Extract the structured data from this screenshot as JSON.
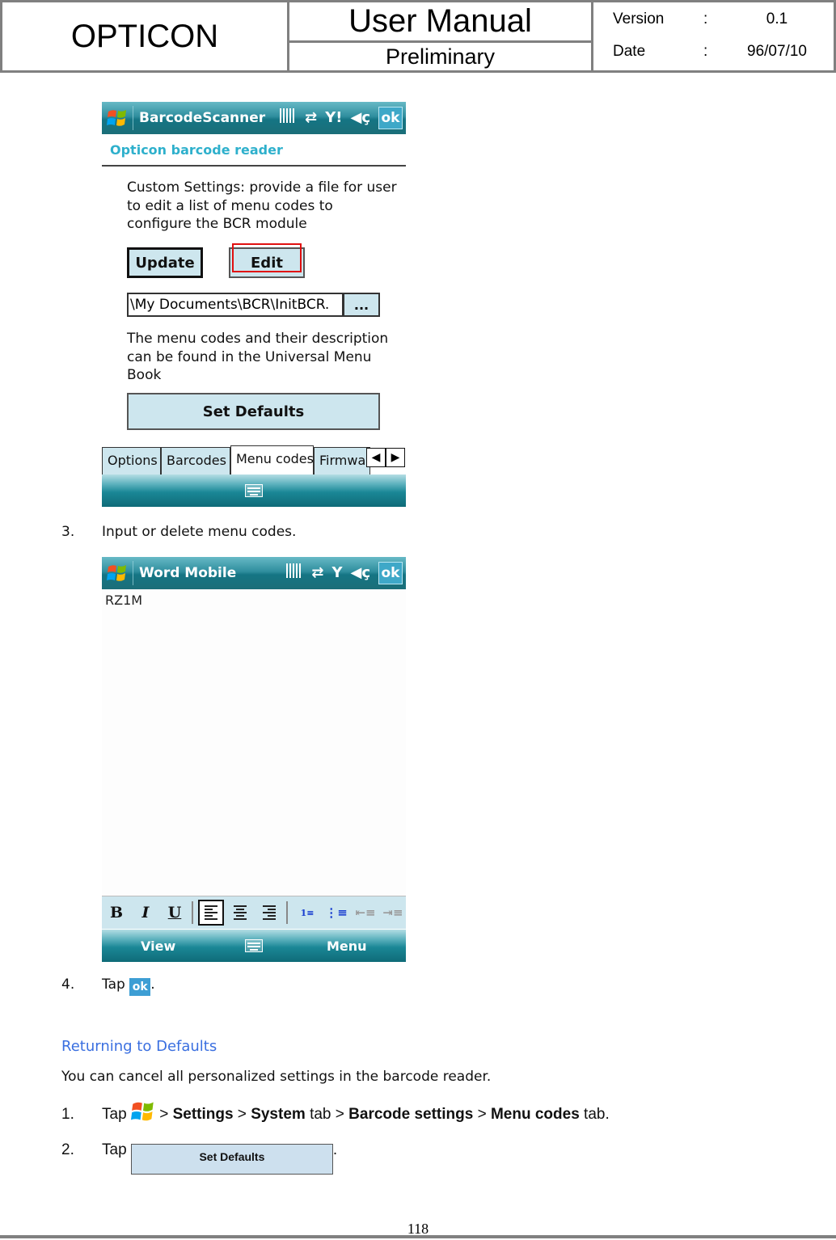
{
  "header": {
    "brand": "OPTICON",
    "title": "User Manual",
    "subtitle": "Preliminary",
    "version_label": "Version",
    "version_sep": ":",
    "version_value": "0.1",
    "date_label": "Date",
    "date_sep": ":",
    "date_value": "96/07/10"
  },
  "screen1": {
    "app_title": "BarcodeScanner",
    "title_icons": [
      "barcode-icon",
      "connectivity-icon",
      "signal-icon",
      "volume-icon"
    ],
    "ok_label": "ok",
    "app_header": "Opticon barcode reader",
    "description": "Custom Settings: provide a file for user to edit a list of menu codes to configure the BCR module",
    "update_label": "Update",
    "edit_label": "Edit",
    "file_path": "\\My Documents\\BCR\\InitBCR.",
    "browse_label": "...",
    "info_text": "The menu codes and their description can be found in the Universal Menu Book",
    "set_defaults_label": "Set Defaults",
    "tabs": [
      {
        "label": "Options",
        "active": false
      },
      {
        "label": "Barcodes",
        "active": false
      },
      {
        "label": "Menu codes",
        "active": true
      },
      {
        "label": "Firmwar",
        "active": false
      }
    ],
    "highlight_color": "#e01010"
  },
  "step3": {
    "num": "3.",
    "text": "Input or delete menu codes."
  },
  "screen2": {
    "app_title": "Word Mobile",
    "ok_label": "ok",
    "document_text": "RZ1M",
    "format_buttons": [
      "bold",
      "italic",
      "underline",
      "align-left",
      "align-center",
      "align-right",
      "numbered-list",
      "bulleted-list",
      "decrease-indent",
      "increase-indent"
    ],
    "bold_label": "B",
    "italic_label": "I",
    "underline_label": "U",
    "softkey_left": "View",
    "softkey_right": "Menu"
  },
  "step4": {
    "num": "4.",
    "prefix": "Tap",
    "ok_label": "ok",
    "suffix": "."
  },
  "section": {
    "title": "Returning to Defaults",
    "intro": "You can cancel all personalized settings in the barcode reader.",
    "step1": {
      "num": "1.",
      "prefix": "Tap",
      "sep1": " > ",
      "settings": "Settings",
      "sep2": " > ",
      "system": "System",
      "tab1": " tab > ",
      "barcode_settings": "Barcode settings",
      "sep3": " > ",
      "menu_codes": "Menu codes",
      "tab2": " tab."
    },
    "step2": {
      "num": "2.",
      "prefix": "Tap",
      "button_label": "Set Defaults",
      "suffix": "."
    },
    "title_color": "#3a6fe0"
  },
  "footer": {
    "page_number": "118"
  }
}
